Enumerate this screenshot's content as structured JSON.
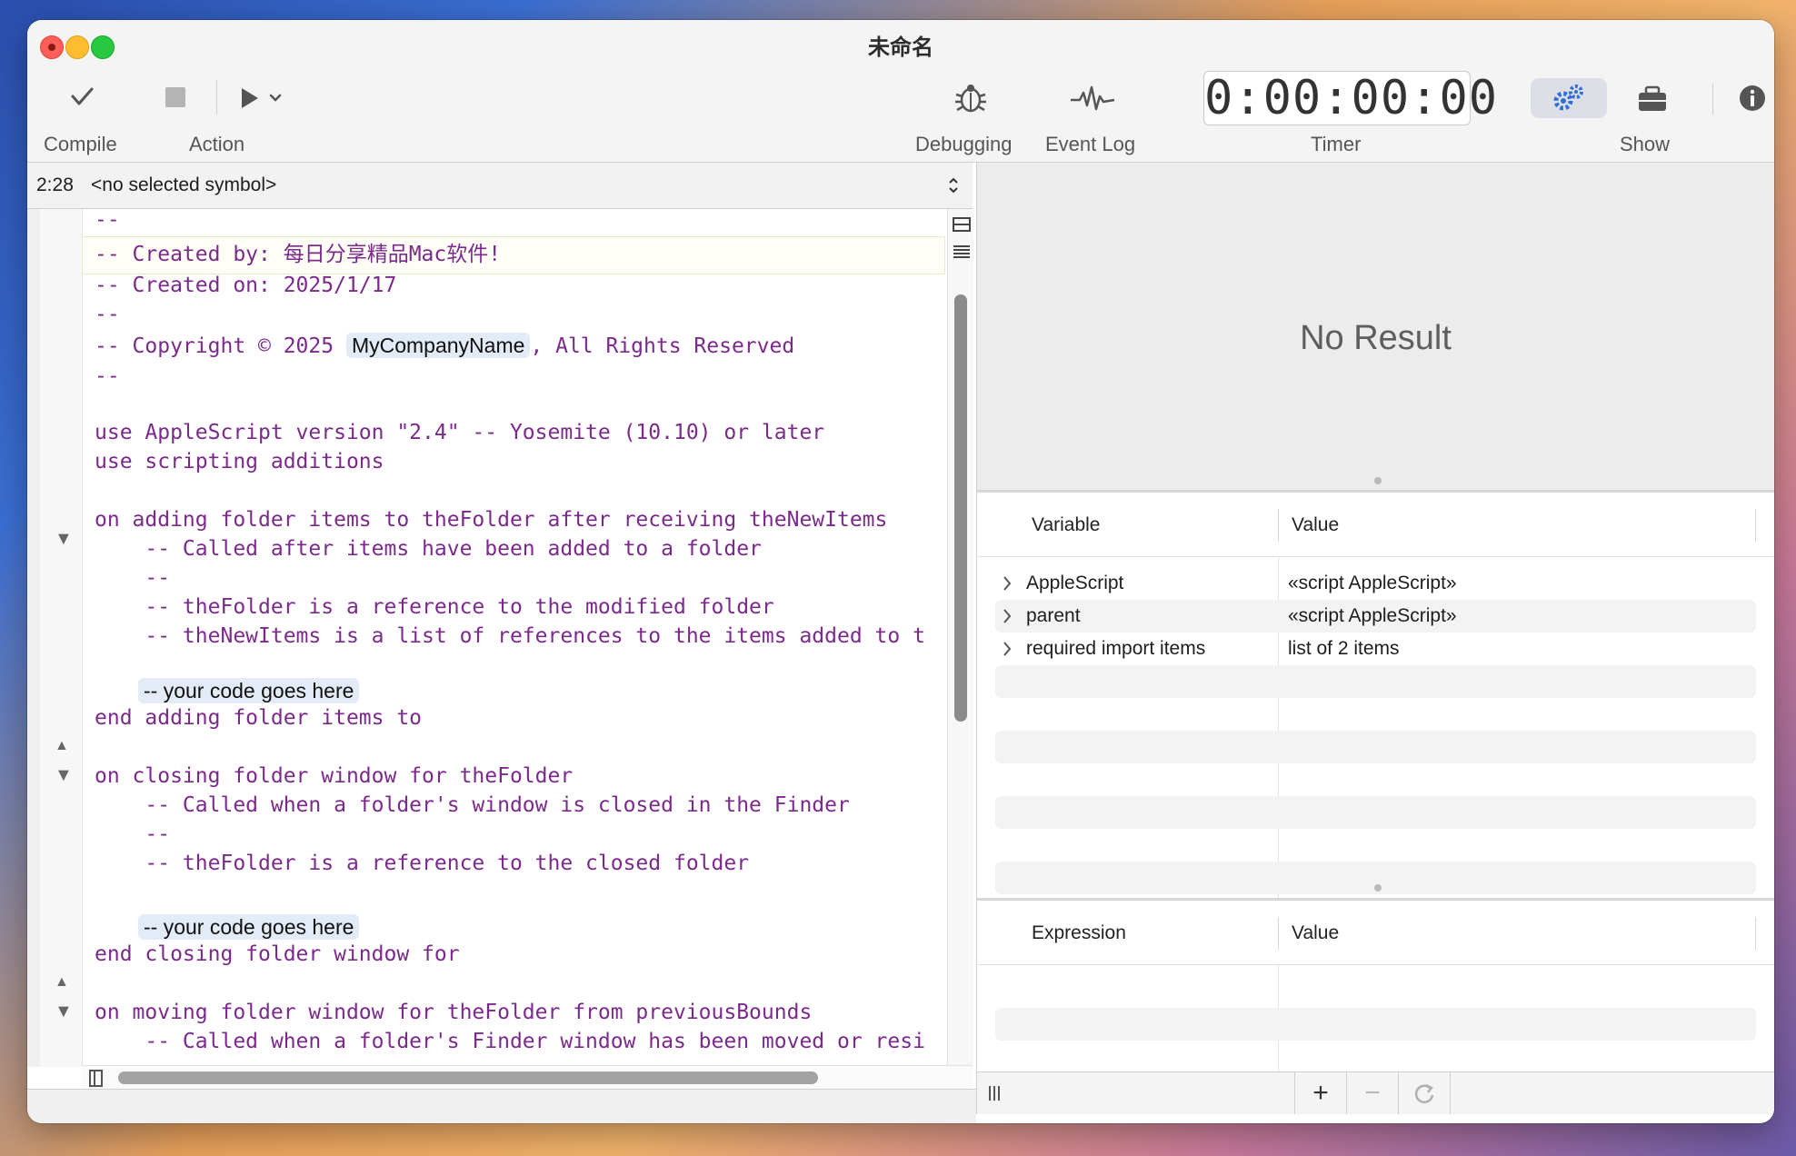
{
  "window": {
    "title": "未命名"
  },
  "toolbar": {
    "compile_label": "Compile",
    "action_label": "Action",
    "debugging_label": "Debugging",
    "event_log_label": "Event Log",
    "timer_label": "Timer",
    "timer_value": "0:00:00:00",
    "show_label": "Show"
  },
  "navigator": {
    "position": "2:28",
    "symbol": "<no selected symbol>"
  },
  "editor": {
    "lines": [
      "--",
      "-- Created by: 每日分享精品Mac软件!",
      "-- Created on: 2025/1/17",
      "--",
      "-- Copyright © 2025 ",
      "MyCompanyName",
      ", All Rights Reserved",
      "--",
      "use AppleScript version \"2.4\" -- Yosemite (10.10) or later",
      "use scripting additions",
      "on adding folder items to theFolder after receiving theNewItems",
      "    -- Called after items have been added to a folder",
      "    --",
      "    -- theFolder is a reference to the modified folder",
      "    -- theNewItems is a list of references to the items added to t",
      "-- your code goes here",
      "end adding folder items to",
      "on closing folder window for theFolder",
      "    -- Called when a folder's window is closed in the Finder",
      "    --",
      "    -- theFolder is a reference to the closed folder",
      "-- your code goes here",
      "end closing folder window for",
      "on moving folder window for theFolder from previousBounds",
      "    -- Called when a folder's Finder window has been moved or resi"
    ]
  },
  "result": {
    "text": "No Result"
  },
  "variables": {
    "col_variable": "Variable",
    "col_value": "Value",
    "rows": [
      {
        "name": "AppleScript",
        "value": "«script AppleScript»"
      },
      {
        "name": "parent",
        "value": "«script AppleScript»"
      },
      {
        "name": "required import items",
        "value": "list of 2 items"
      }
    ]
  },
  "expressions": {
    "col_expression": "Expression",
    "col_value": "Value"
  },
  "bottom_bar": {
    "add_symbol": "+",
    "remove_symbol": "−"
  },
  "colors": {
    "code_text": "#7b2a8c",
    "accent_blue": "#2f6fd6",
    "traffic_red": "#ff5f57",
    "traffic_yellow": "#febc2e",
    "traffic_green": "#28c840"
  }
}
